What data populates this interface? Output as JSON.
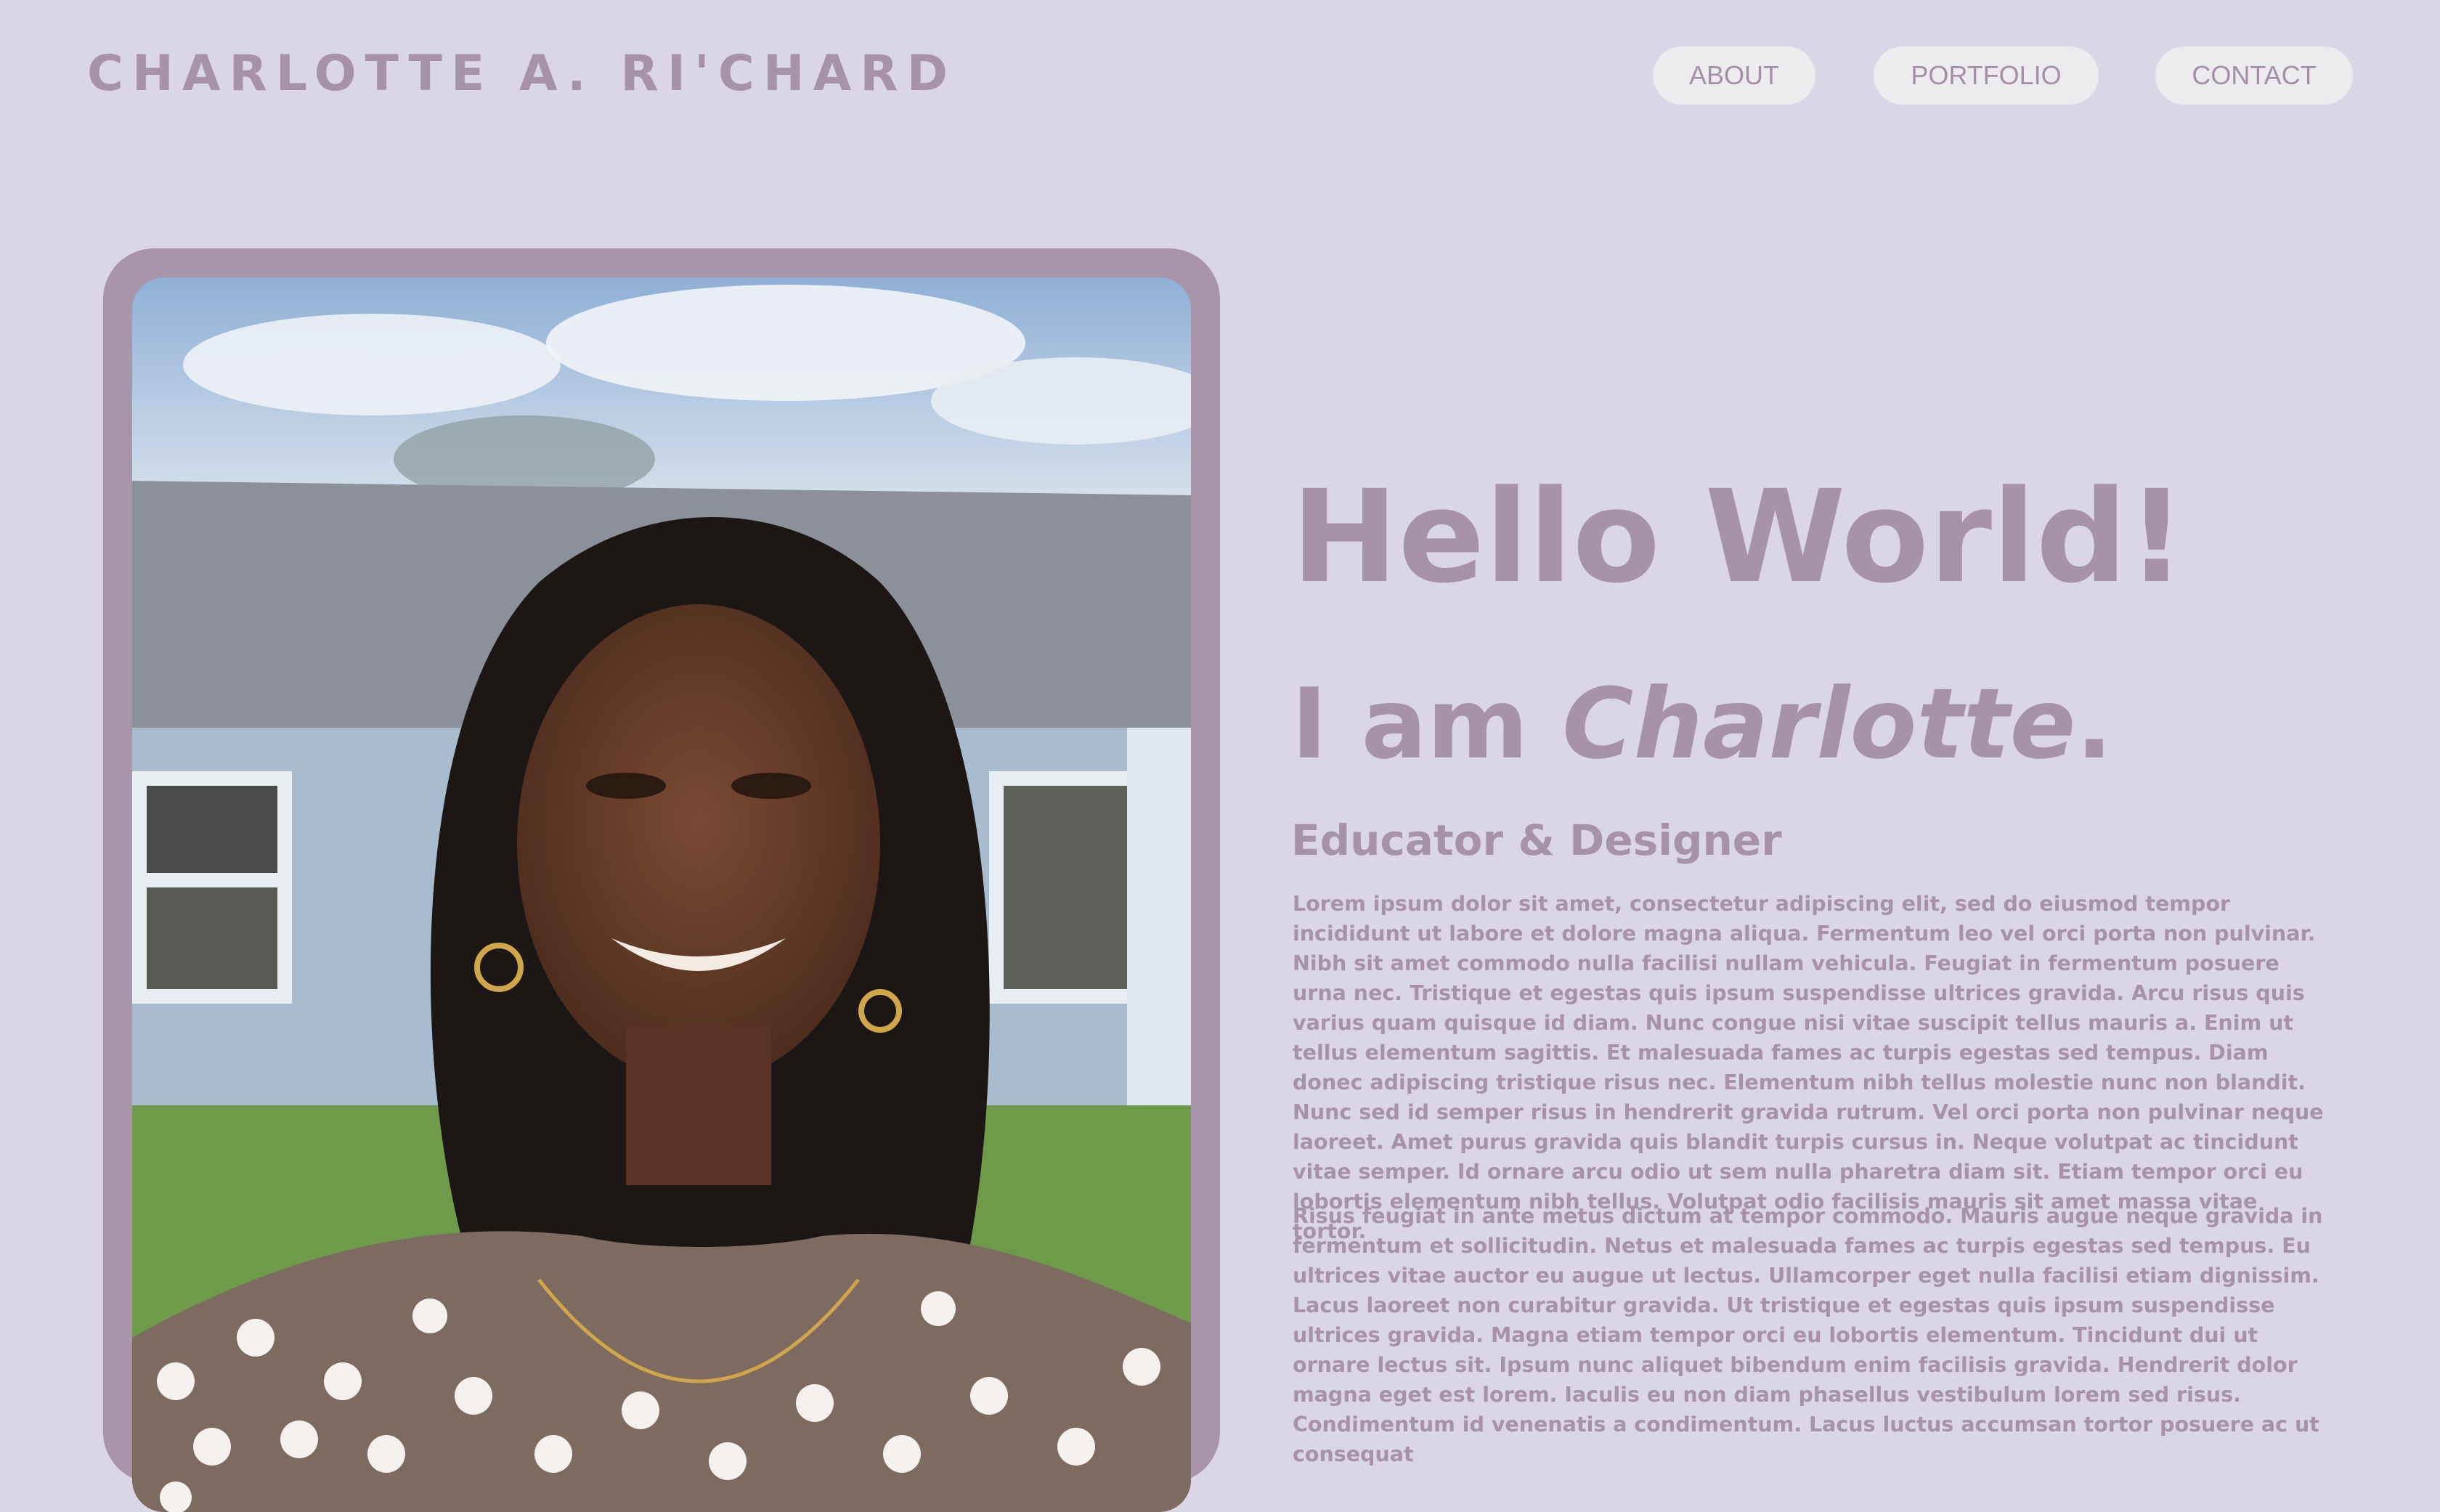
{
  "header": {
    "logo": "CHARLOTTE A. RI'CHARD",
    "nav": [
      "ABOUT",
      "PORTFOLIO",
      "CONTACT"
    ]
  },
  "hero": {
    "greeting": "Hello World!",
    "intro_prefix": "I am ",
    "name": "Charlotte",
    "intro_suffix": ".",
    "role": "Educator & Designer",
    "paragraphs": [
      "Lorem ipsum dolor sit amet, consectetur adipiscing elit, sed do eiusmod tempor incididunt ut labore et dolore magna aliqua. Fermentum leo vel orci porta non pulvinar. Nibh sit amet commodo nulla facilisi nullam vehicula. Feugiat in fermentum posuere urna nec. Tristique et egestas quis ipsum suspendisse ultrices gravida. Arcu risus quis varius quam quisque id diam. Nunc congue nisi vitae suscipit tellus mauris a. Enim ut tellus elementum sagittis. Et malesuada fames ac turpis egestas sed tempus. Diam donec adipiscing tristique risus nec. Elementum nibh tellus molestie nunc non blandit. Nunc sed id semper risus in hendrerit gravida rutrum. Vel orci porta non pulvinar neque laoreet. Amet purus gravida quis blandit turpis cursus in. Neque volutpat ac tincidunt vitae semper. Id ornare arcu odio ut sem nulla pharetra diam sit. Etiam tempor orci eu lobortis elementum nibh tellus. Volutpat odio facilisis mauris sit amet massa vitae tortor.",
      "Risus feugiat in ante metus dictum at tempor commodo. Mauris augue neque gravida in fermentum et sollicitudin. Netus et malesuada fames ac turpis egestas sed tempus. Eu ultrices vitae auctor eu augue ut lectus. Ullamcorper eget nulla facilisi etiam dignissim. Lacus laoreet non curabitur gravida. Ut tristique et egestas quis ipsum suspendisse ultrices gravida. Magna etiam tempor orci eu lobortis elementum. Tincidunt dui ut ornare lectus sit. Ipsum nunc aliquet bibendum enim facilisis gravida. Hendrerit dolor magna eget est lorem. Iaculis eu non diam phasellus vestibulum lorem sed risus. Condimentum id venenatis a condimentum. Lacus luctus accumsan tortor posuere ac ut consequat"
    ]
  },
  "colors": {
    "background": "#dad6e6",
    "accent": "#a793a8",
    "button_bg": "#ececef"
  }
}
